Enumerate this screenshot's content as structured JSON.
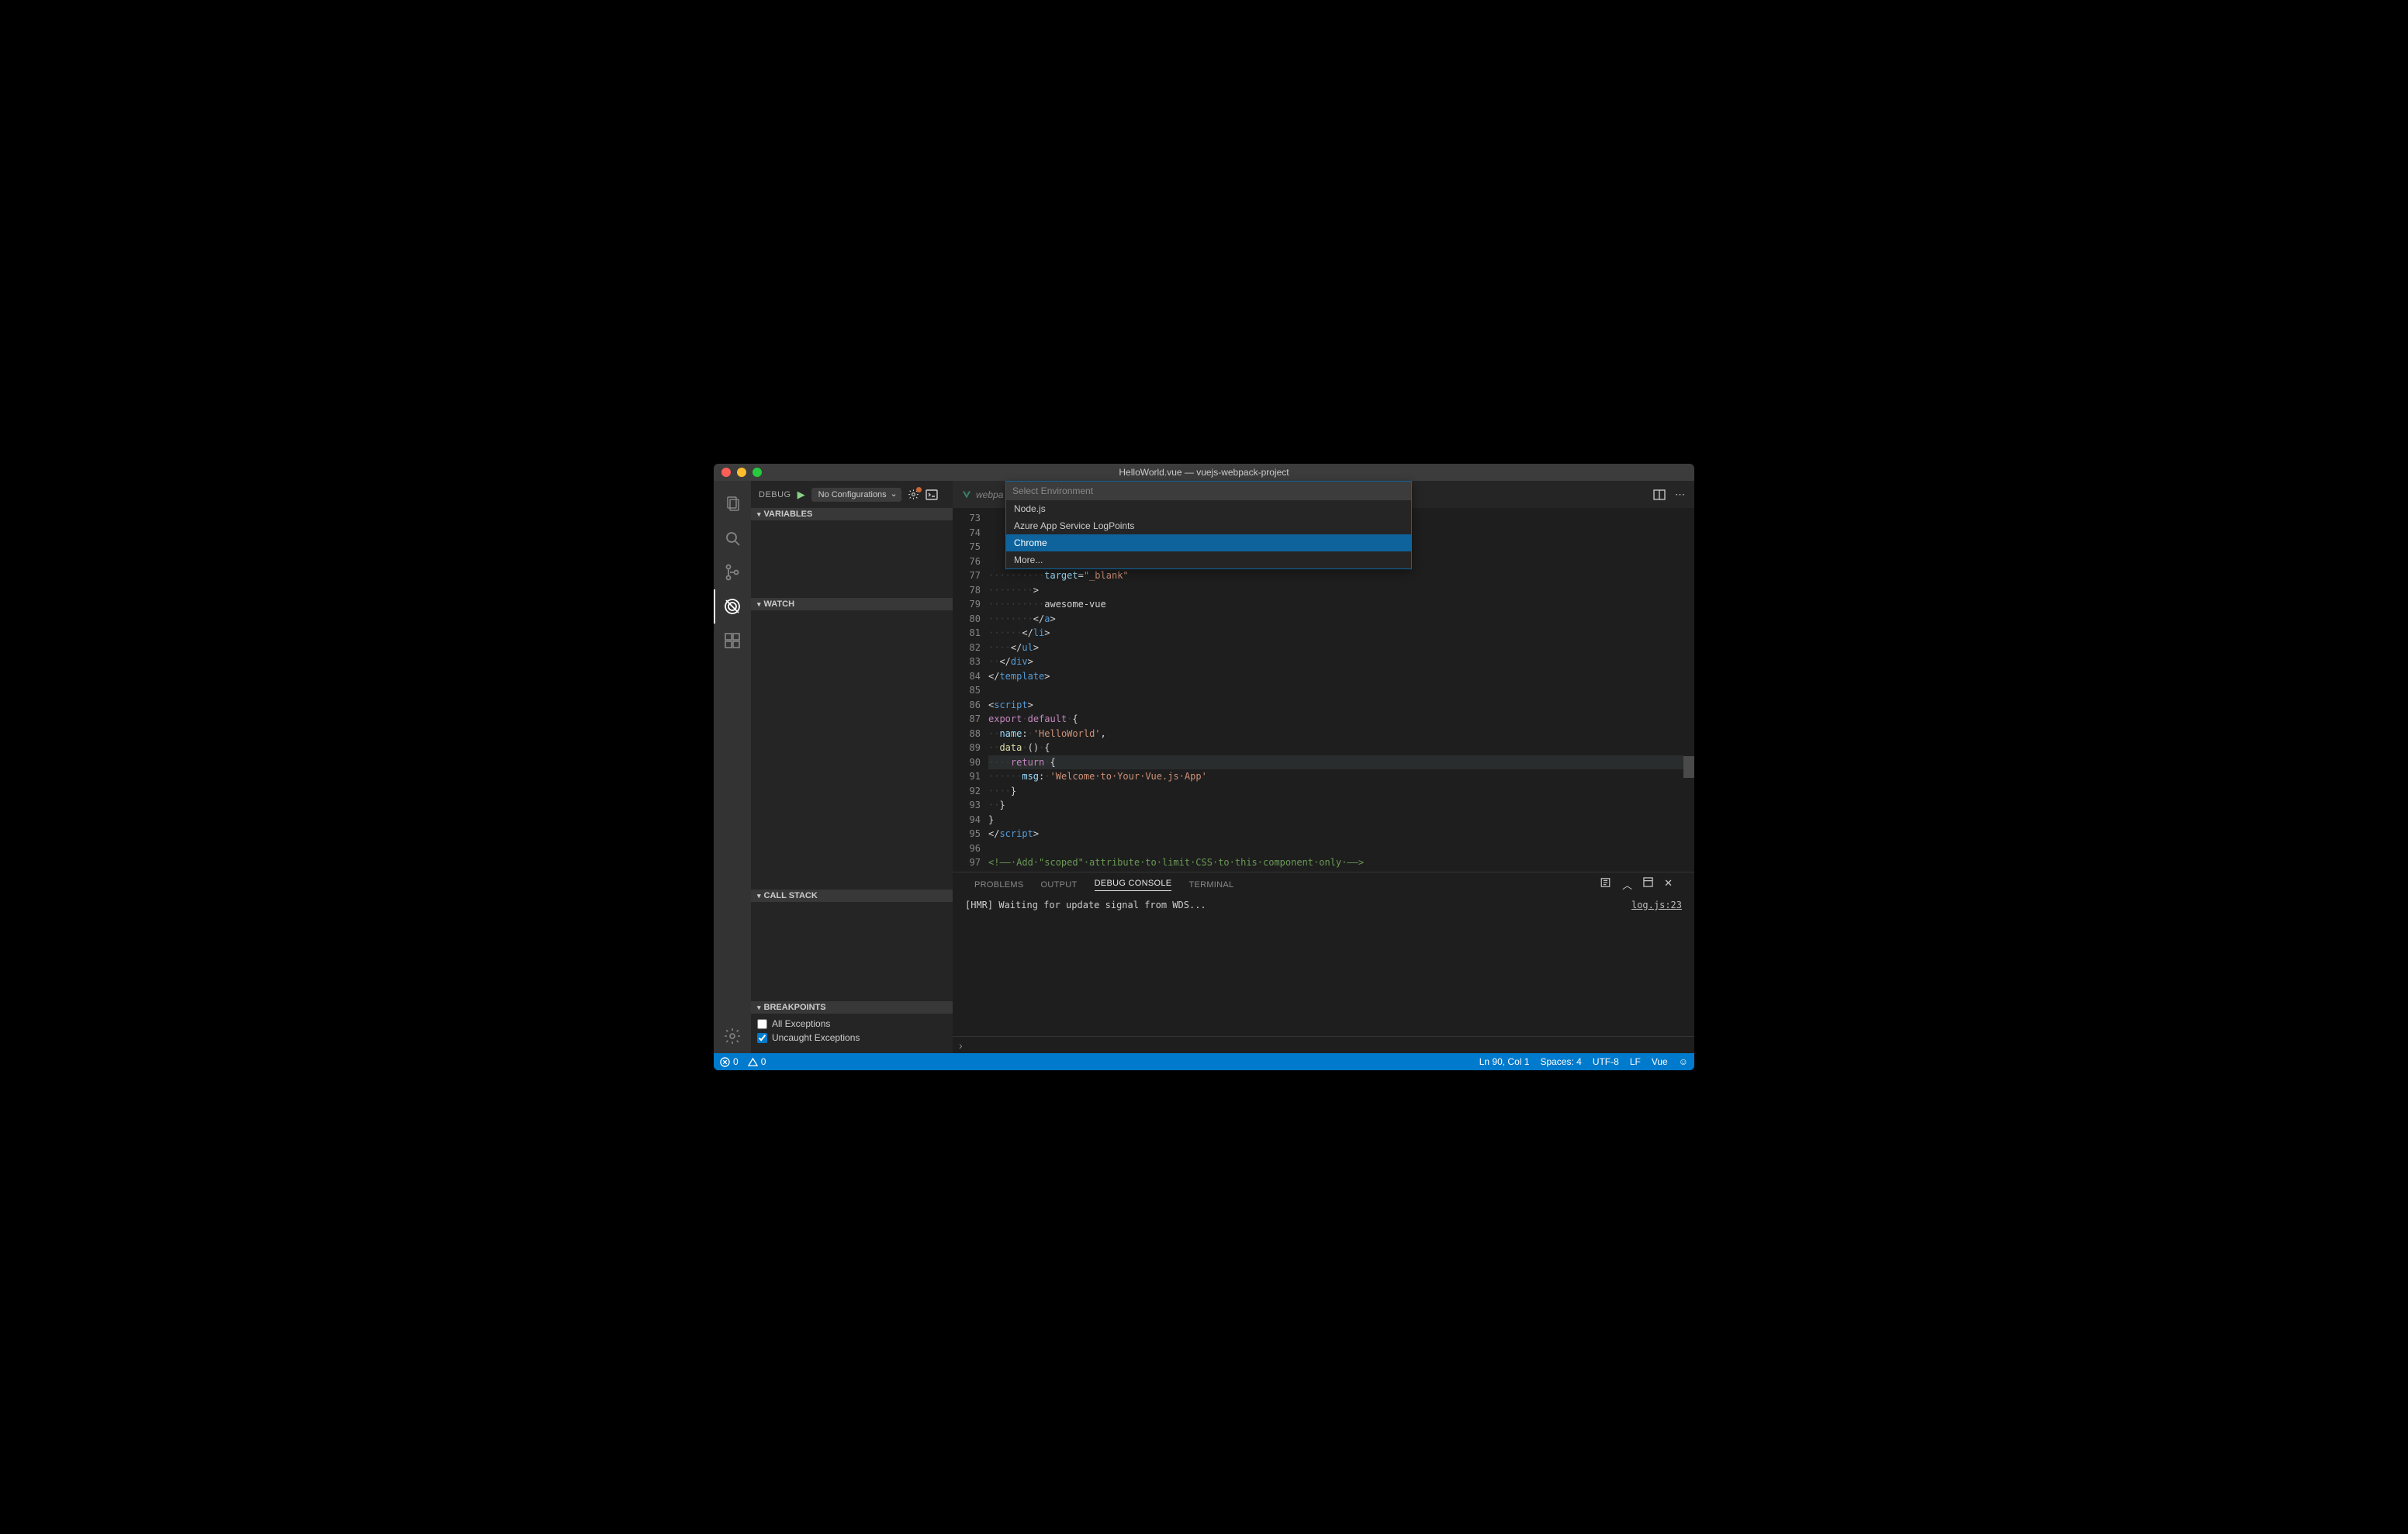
{
  "window": {
    "title": "HelloWorld.vue — vuejs-webpack-project"
  },
  "activitybar": {
    "items": [
      "files-icon",
      "search-icon",
      "scm-icon",
      "debug-icon",
      "extensions-icon"
    ],
    "bottom": "gear-icon"
  },
  "debug": {
    "label": "DEBUG",
    "config": "No Configurations",
    "sections": {
      "variables": "VARIABLES",
      "watch": "WATCH",
      "callstack": "CALL STACK",
      "breakpoints": "BREAKPOINTS"
    },
    "breakpoints": {
      "all": {
        "label": "All Exceptions",
        "checked": false
      },
      "uncaught": {
        "label": "Uncaught Exceptions",
        "checked": true
      }
    }
  },
  "tabs": {
    "open": {
      "icon": "vue-icon",
      "label": "webpa"
    }
  },
  "dropdown": {
    "placeholder": "Select Environment",
    "items": [
      "Node.js",
      "Azure App Service LogPoints",
      "Chrome",
      "More..."
    ],
    "selected": "Chrome"
  },
  "editor": {
    "firstLine": 73,
    "highlightLine": 90,
    "lines": [
      {
        "n": 73,
        "html": ""
      },
      {
        "n": 74,
        "html": ""
      },
      {
        "n": 75,
        "html": ""
      },
      {
        "n": 76,
        "html": ""
      },
      {
        "n": 77,
        "html": "<span class='ws'>··········</span><span class='t-attr'>target</span>=<span class='t-str'>\"_blank\"</span>"
      },
      {
        "n": 78,
        "html": "<span class='ws'>········</span>&gt;"
      },
      {
        "n": 79,
        "html": "<span class='ws'>··········</span>awesome-vue"
      },
      {
        "n": 80,
        "html": "<span class='ws'>········</span>&lt;/<span class='t-tag'>a</span>&gt;"
      },
      {
        "n": 81,
        "html": "<span class='ws'>······</span>&lt;/<span class='t-tag'>li</span>&gt;"
      },
      {
        "n": 82,
        "html": "<span class='ws'>····</span>&lt;/<span class='t-tag'>ul</span>&gt;"
      },
      {
        "n": 83,
        "html": "<span class='ws'>··</span>&lt;/<span class='t-tag'>div</span>&gt;"
      },
      {
        "n": 84,
        "html": "&lt;/<span class='t-tag'>template</span>&gt;"
      },
      {
        "n": 85,
        "html": ""
      },
      {
        "n": 86,
        "html": "&lt;<span class='t-tag'>script</span>&gt;"
      },
      {
        "n": 87,
        "html": "<span class='t-kw'>export</span><span class='ws'>·</span><span class='t-kw'>default</span><span class='ws'>·</span>{"
      },
      {
        "n": 88,
        "html": "<span class='ws'>··</span><span class='t-attr'>name</span>:<span class='ws'>·</span><span class='t-str'>'HelloWorld'</span>,"
      },
      {
        "n": 89,
        "html": "<span class='ws'>··</span><span class='t-fn'>data</span><span class='ws'>·</span>()<span class='ws'>·</span>{"
      },
      {
        "n": 90,
        "html": "<span class='ws'>····</span><span class='t-kw'>return</span><span class='ws'>·</span>{"
      },
      {
        "n": 91,
        "html": "<span class='ws'>······</span><span class='t-attr'>msg</span>:<span class='ws'>·</span><span class='t-str'>'Welcome·to·Your·Vue.js·App'</span>"
      },
      {
        "n": 92,
        "html": "<span class='ws'>····</span>}"
      },
      {
        "n": 93,
        "html": "<span class='ws'>··</span>}"
      },
      {
        "n": 94,
        "html": "}"
      },
      {
        "n": 95,
        "html": "&lt;/<span class='t-tag'>script</span>&gt;"
      },
      {
        "n": 96,
        "html": ""
      },
      {
        "n": 97,
        "html": "<span class='t-cmt'>&lt;!——·Add·\"scoped\"·attribute·to·limit·CSS·to·this·component·only·——&gt;</span>"
      }
    ]
  },
  "panel": {
    "tabs": [
      "PROBLEMS",
      "OUTPUT",
      "DEBUG CONSOLE",
      "TERMINAL"
    ],
    "active": "DEBUG CONSOLE",
    "output": "[HMR] Waiting for update signal from WDS...",
    "source": "log.js:23"
  },
  "statusbar": {
    "errors": "0",
    "warnings": "0",
    "position": "Ln 90, Col 1",
    "spaces": "Spaces: 4",
    "encoding": "UTF-8",
    "eol": "LF",
    "language": "Vue",
    "feedback": "☺"
  }
}
